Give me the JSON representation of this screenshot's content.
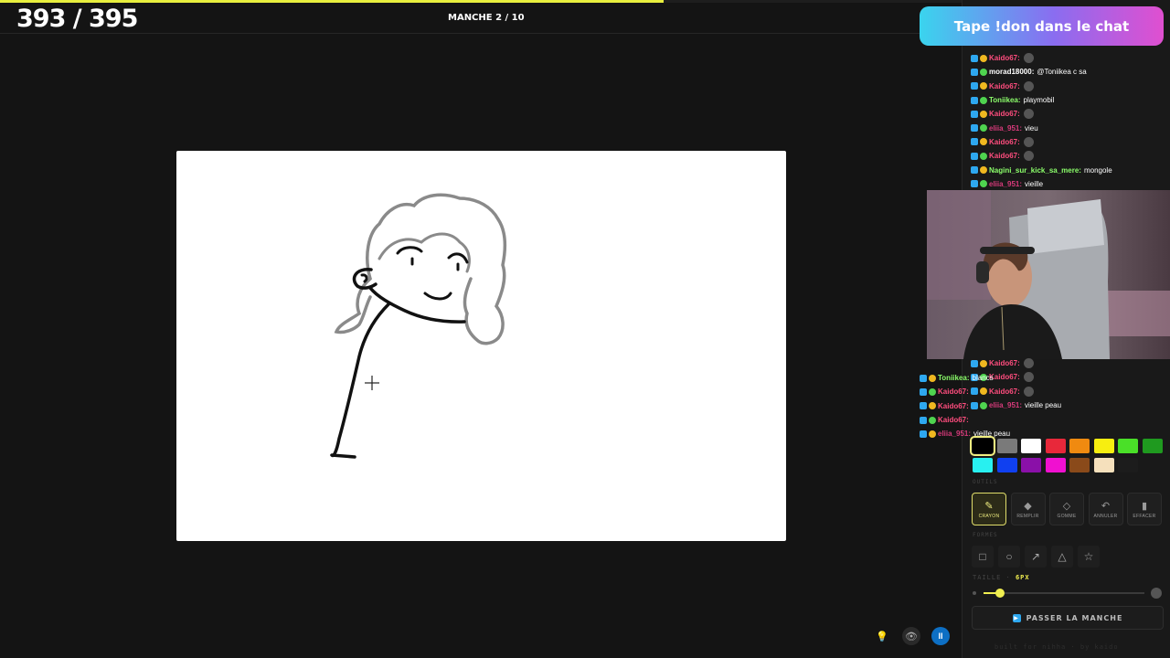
{
  "game": {
    "score": "393 / 395",
    "round": "MANCHE 2 / 10",
    "progress": 0.69
  },
  "banner": {
    "text": "Tape !don dans le chat"
  },
  "chat_top": [
    {
      "user": "Kaido67:",
      "color": "#ff4d7e",
      "msg": "",
      "emote": true
    },
    {
      "user": "morad18000:",
      "color": "#ffffff",
      "msg": "@Toniikea c sa",
      "emote": false
    },
    {
      "user": "Kaido67:",
      "color": "#ff4d7e",
      "msg": "",
      "emote": true
    },
    {
      "user": "Toniikea:",
      "color": "#8cff6b",
      "msg": "playmobil",
      "emote": false
    },
    {
      "user": "Kaido67:",
      "color": "#ff4d7e",
      "msg": "",
      "emote": true
    },
    {
      "user": "eliia_951:",
      "color": "#d63a7a",
      "msg": "vieu",
      "emote": false
    },
    {
      "user": "Kaido67:",
      "color": "#ff4d7e",
      "msg": "",
      "emote": true
    },
    {
      "user": "Kaido67:",
      "color": "#ff4d7e",
      "msg": "",
      "emote": true
    },
    {
      "user": "Nagini_sur_kick_sa_mere:",
      "color": "#8cff6b",
      "msg": "mongole",
      "emote": false
    },
    {
      "user": "eliia_951:",
      "color": "#d63a7a",
      "msg": "vieille",
      "emote": false
    }
  ],
  "chat_bottom": [
    {
      "user": "Kaido67:",
      "color": "#ff4d7e",
      "msg": "",
      "emote": true
    },
    {
      "user": "Kaido67:",
      "color": "#ff4d7e",
      "msg": "",
      "emote": true
    },
    {
      "user": "Kaido67:",
      "color": "#ff4d7e",
      "msg": "",
      "emote": true
    },
    {
      "user": "eliia_951:",
      "color": "#d63a7a",
      "msg": "vieille peau",
      "emote": false
    }
  ],
  "chat_overlay": [
    {
      "user": "Toniikea:",
      "color": "#8cff6b",
      "msg": "blancs"
    },
    {
      "user": "Kaido67:",
      "color": "#ff4d7e",
      "msg": ""
    },
    {
      "user": "Kaido67:",
      "color": "#ff4d7e",
      "msg": ""
    },
    {
      "user": "Kaido67:",
      "color": "#ff4d7e",
      "msg": ""
    },
    {
      "user": "eliia_951:",
      "color": "#d63a7a",
      "msg": "vieille peau"
    }
  ],
  "palette": [
    "#000000",
    "#7a7a7a",
    "#ffffff",
    "#e8283a",
    "#f08a10",
    "#f7ee10",
    "#4ae028",
    "#1f9a1f",
    "#28f0f0",
    "#1040f0",
    "#8a10a8",
    "#f010d0",
    "#8a4a1a",
    "#f5e0bc",
    "#1c1c1c"
  ],
  "labels": {
    "outils": "OUTILS",
    "formes": "FORMES",
    "taille": "TAILLE · ",
    "taille_val": "6PX",
    "skip": "PASSER LA MANCHE",
    "footer": "built for nihha · by kaido"
  },
  "tools": [
    {
      "label": "CRAYON",
      "icon": "✎"
    },
    {
      "label": "REMPLIR",
      "icon": "◆"
    },
    {
      "label": "GOMME",
      "icon": "◇"
    },
    {
      "label": "ANNULER",
      "icon": "↶"
    },
    {
      "label": "EFFACER",
      "icon": "▮"
    }
  ],
  "shapes": [
    {
      "name": "rectangle",
      "icon": "□"
    },
    {
      "name": "ellipse",
      "icon": "○"
    },
    {
      "name": "arrow",
      "icon": "↗"
    },
    {
      "name": "triangle",
      "icon": "△"
    },
    {
      "name": "star",
      "icon": "☆"
    }
  ],
  "brush": {
    "size_fraction": 0.1
  },
  "controls": {
    "hint": "💡",
    "eye": "👁",
    "pause": "II"
  }
}
